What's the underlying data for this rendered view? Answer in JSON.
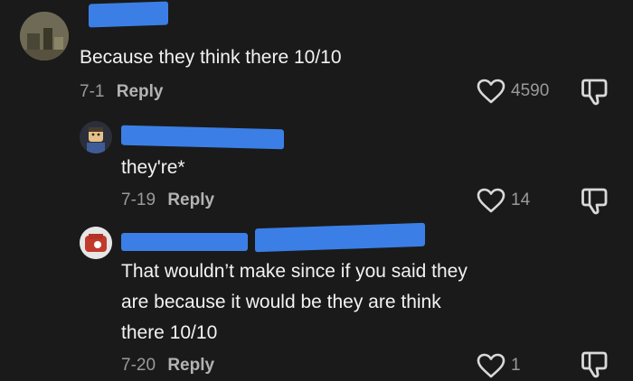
{
  "comments": [
    {
      "text": "Because they think there 10/10",
      "date": "7-1",
      "reply_label": "Reply",
      "likes": "4590"
    },
    {
      "text": "they're*",
      "date": "7-19",
      "reply_label": "Reply",
      "likes": "14"
    },
    {
      "text_lines": [
        "That wouldn’t make since if you said they",
        "are because it would be they are think",
        "there 10/10"
      ],
      "date": "7-20",
      "reply_label": "Reply",
      "likes": "1"
    }
  ],
  "colors": {
    "background": "#1a1a1a",
    "redaction": "#3b7fe6",
    "text": "#f2f2f2",
    "muted": "#9a9a9a"
  },
  "icons": [
    "heart-outline-icon",
    "thumbs-down-icon"
  ]
}
